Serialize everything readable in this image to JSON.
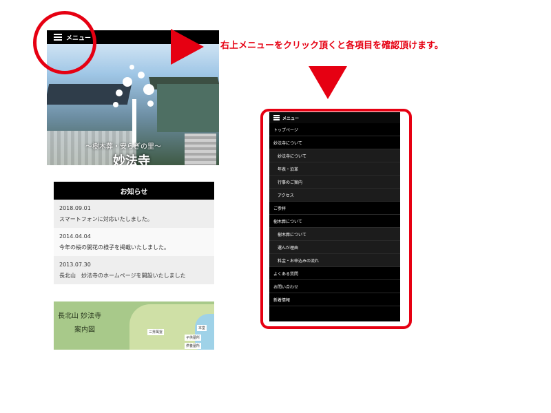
{
  "left_screenshot": {
    "menu_label": "メニュー",
    "tagline": "～樹木葬・安らぎの里～",
    "temple_name": "妙法寺"
  },
  "instruction_text": "右上メニューをクリック頂くと各項目を確認頂けます。",
  "news": {
    "title": "お知らせ",
    "items": [
      {
        "date": "2018.09.01",
        "text": "スマートフォンに対応いたしました。"
      },
      {
        "date": "2014.04.04",
        "text": "今年の桜の開花の様子を掲載いたしました。"
      },
      {
        "date": "2013.07.30",
        "text": "長北山　妙法寺のホームページを開設いたしました"
      }
    ]
  },
  "map": {
    "title": "長北山 妙法寺",
    "subtitle": "案内図",
    "labels": [
      "本堂",
      "三界萬霊",
      "子供墓所",
      "供養墓所"
    ]
  },
  "menu": {
    "label": "メニュー",
    "items": [
      {
        "label": "トップページ",
        "sub": false
      },
      {
        "label": "妙法寺について",
        "sub": false
      },
      {
        "label": "妙法寺について",
        "sub": true
      },
      {
        "label": "年表・沿革",
        "sub": true
      },
      {
        "label": "行事のご案内",
        "sub": true
      },
      {
        "label": "アクセス",
        "sub": true
      },
      {
        "label": "ご参拝",
        "sub": false
      },
      {
        "label": "樹木葬について",
        "sub": false
      },
      {
        "label": "樹木葬について",
        "sub": true
      },
      {
        "label": "選んだ理由",
        "sub": true
      },
      {
        "label": "料金・お申込みの流れ",
        "sub": true
      },
      {
        "label": "よくある質問",
        "sub": false
      },
      {
        "label": "お問い合わせ",
        "sub": false
      },
      {
        "label": "新着情報",
        "sub": false
      }
    ]
  },
  "colors": {
    "accent_red": "#e60012",
    "menu_bg": "#000000"
  }
}
